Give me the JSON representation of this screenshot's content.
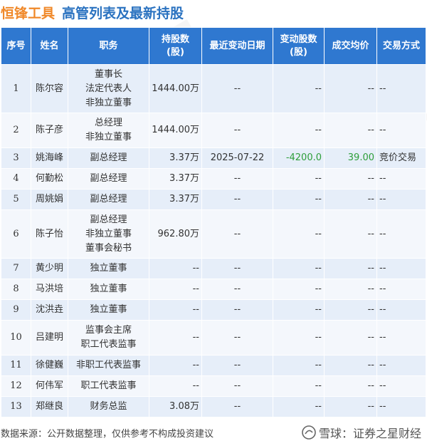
{
  "header": {
    "company": "恒锋工具",
    "title": "高管列表及最新持股"
  },
  "table": {
    "columns": [
      "序号",
      "姓名",
      "职务",
      "持股数\n(股)",
      "最近变动日期",
      "变动股数\n(股)",
      "成交均价",
      "交易方式"
    ],
    "rows": [
      {
        "no": "1",
        "name": "陈尔容",
        "position": [
          "董事长",
          "法定代表人",
          "非独立董事"
        ],
        "shares": "1444.00万",
        "date": "--",
        "change": "--",
        "price": "--",
        "method": "--"
      },
      {
        "no": "2",
        "name": "陈子彦",
        "position": [
          "总经理",
          "非独立董事"
        ],
        "shares": "1444.00万",
        "date": "--",
        "change": "--",
        "price": "--",
        "method": "--"
      },
      {
        "no": "3",
        "name": "姚海峰",
        "position": [
          "副总经理"
        ],
        "shares": "3.37万",
        "date": "2025-07-22",
        "change": "-4200.0",
        "price": "39.00",
        "method": "竞价交易"
      },
      {
        "no": "4",
        "name": "何勤松",
        "position": [
          "副总经理"
        ],
        "shares": "3.37万",
        "date": "--",
        "change": "--",
        "price": "--",
        "method": "--"
      },
      {
        "no": "5",
        "name": "周姚娟",
        "position": [
          "副总经理"
        ],
        "shares": "3.37万",
        "date": "--",
        "change": "--",
        "price": "--",
        "method": "--"
      },
      {
        "no": "6",
        "name": "陈子怡",
        "position": [
          "副总经理",
          "非独立董事",
          "董事会秘书"
        ],
        "shares": "962.80万",
        "date": "--",
        "change": "--",
        "price": "--",
        "method": "--"
      },
      {
        "no": "7",
        "name": "黄少明",
        "position": [
          "独立董事"
        ],
        "shares": "--",
        "date": "--",
        "change": "--",
        "price": "--",
        "method": "--"
      },
      {
        "no": "8",
        "name": "马洪培",
        "position": [
          "独立董事"
        ],
        "shares": "--",
        "date": "--",
        "change": "--",
        "price": "--",
        "method": "--"
      },
      {
        "no": "9",
        "name": "沈洪垚",
        "position": [
          "独立董事"
        ],
        "shares": "--",
        "date": "--",
        "change": "--",
        "price": "--",
        "method": "--"
      },
      {
        "no": "10",
        "name": "吕建明",
        "position": [
          "监事会主席",
          "职工代表监事"
        ],
        "shares": "--",
        "date": "--",
        "change": "--",
        "price": "--",
        "method": "--"
      },
      {
        "no": "11",
        "name": "徐健巍",
        "position": [
          "非职工代表监事"
        ],
        "shares": "--",
        "date": "--",
        "change": "--",
        "price": "--",
        "method": "--"
      },
      {
        "no": "12",
        "name": "何伟军",
        "position": [
          "职工代表监事"
        ],
        "shares": "--",
        "date": "--",
        "change": "--",
        "price": "--",
        "method": "--"
      },
      {
        "no": "13",
        "name": "郑继良",
        "position": [
          "财务总监"
        ],
        "shares": "3.08万",
        "date": "--",
        "change": "--",
        "price": "--",
        "method": "--"
      }
    ]
  },
  "footer": {
    "source": "数据来源：公开数据整理，仅供参考不构成投资建议",
    "brand": "雪球：证券之星财经"
  },
  "watermark": "证券之星",
  "colors": {
    "header_bg": "#2f78d0",
    "company": "#f0892a",
    "title": "#2a72c0",
    "row_odd": "#e6eef9",
    "row_even": "#f4f7fc",
    "negative": "#2e9e3a"
  }
}
